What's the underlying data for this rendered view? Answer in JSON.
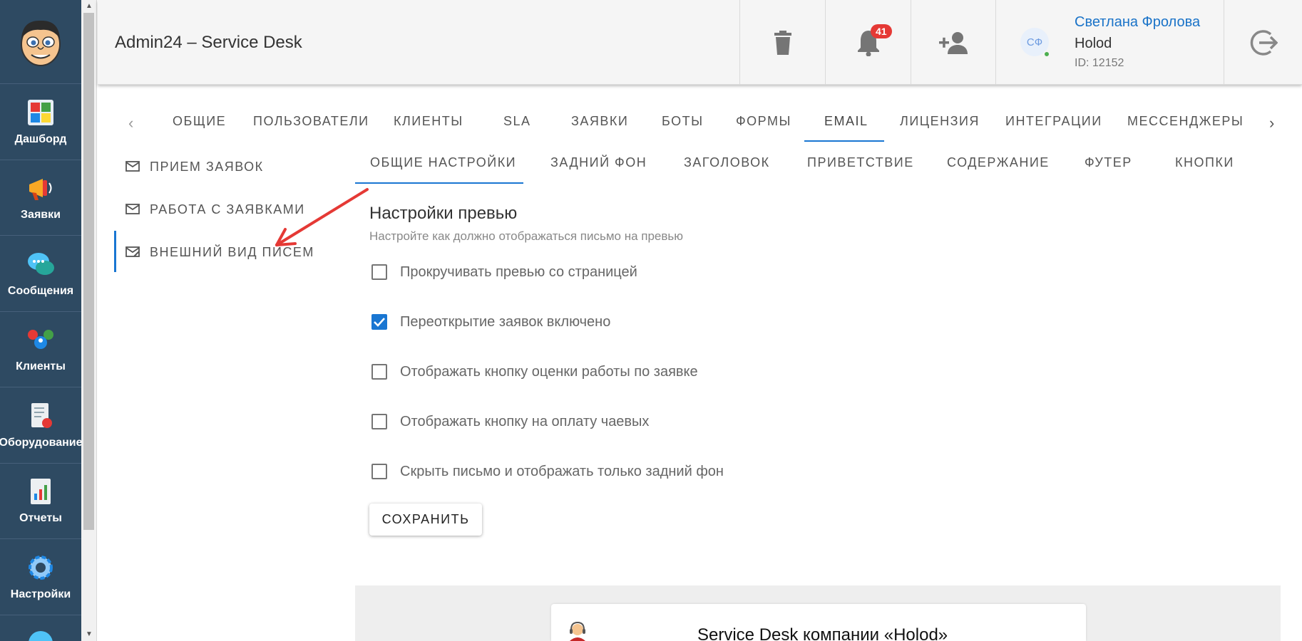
{
  "sidebar": {
    "items": [
      {
        "label": "Дашборд",
        "icon": "dashboard-icon"
      },
      {
        "label": "Заявки",
        "icon": "megaphone-icon"
      },
      {
        "label": "Сообщения",
        "icon": "chat-icon"
      },
      {
        "label": "Клиенты",
        "icon": "clients-icon"
      },
      {
        "label": "Оборудование",
        "icon": "equipment-icon"
      },
      {
        "label": "Отчеты",
        "icon": "reports-icon"
      },
      {
        "label": "Настройки",
        "icon": "gear-icon"
      }
    ]
  },
  "header": {
    "title": "Admin24 – Service Desk",
    "notifications_count": "41",
    "user": {
      "initials": "СФ",
      "name": "Светлана Фролова",
      "company": "Holod",
      "id": "ID: 12152"
    }
  },
  "tabs": [
    "ОБЩИЕ",
    "ПОЛЬЗОВАТЕЛИ",
    "КЛИЕНТЫ",
    "SLA",
    "ЗАЯВКИ",
    "БОТЫ",
    "ФОРМЫ",
    "EMAIL",
    "ЛИЦЕНЗИЯ",
    "ИНТЕГРАЦИИ",
    "МЕССЕНДЖЕРЫ"
  ],
  "active_tab": "EMAIL",
  "subnav": [
    "ПРИЕМ ЗАЯВОК",
    "РАБОТА С ЗАЯВКАМИ",
    "ВНЕШНИЙ ВИД ПИСЕМ"
  ],
  "active_subnav": "ВНЕШНИЙ ВИД ПИСЕМ",
  "subtabs": [
    "ОБЩИЕ НАСТРОЙКИ",
    "ЗАДНИЙ ФОН",
    "ЗАГОЛОВОК",
    "ПРИВЕТСТВИЕ",
    "СОДЕРЖАНИЕ",
    "ФУТЕР",
    "КНОПКИ"
  ],
  "active_subtab": "ОБЩИЕ НАСТРОЙКИ",
  "section": {
    "title": "Настройки превью",
    "subtitle": "Настройте как должно отображаться письмо на превью"
  },
  "options": [
    {
      "label": "Прокручивать превью со страницей",
      "checked": false
    },
    {
      "label": "Переоткрытие заявок включено",
      "checked": true
    },
    {
      "label": "Отображать кнопку оценки работы по заявке",
      "checked": false
    },
    {
      "label": "Отображать кнопку на оплату чаевых",
      "checked": false
    },
    {
      "label": "Скрыть письмо и отображать только задний фон",
      "checked": false
    }
  ],
  "save_label": "СОХРАНИТЬ",
  "preview": {
    "title": "Service Desk компании «Holod»"
  },
  "colors": {
    "sidebar": "#2e4a62",
    "accent": "#1976d2",
    "badge": "#e53935",
    "user_link": "#1a73c8",
    "annotation_arrow": "#e53935"
  }
}
